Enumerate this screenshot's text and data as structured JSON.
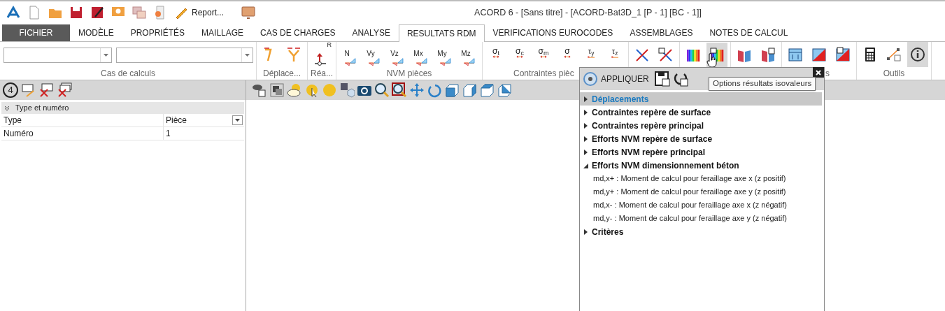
{
  "quick_access": {
    "report_label": "Report..."
  },
  "window_title": "ACORD 6 - [Sans titre] - [ACORD-Bat3D_1 [P - 1] [BC - 1]]",
  "tabs": [
    {
      "label": "FICHIER",
      "selected": false,
      "kind": "file"
    },
    {
      "label": "MODÈLE",
      "selected": false,
      "kind": "tab"
    },
    {
      "label": "PROPRIÉTÉS",
      "selected": false,
      "kind": "tab"
    },
    {
      "label": "MAILLAGE",
      "selected": false,
      "kind": "tab"
    },
    {
      "label": "CAS DE CHARGES",
      "selected": false,
      "kind": "tab"
    },
    {
      "label": "ANALYSE",
      "selected": false,
      "kind": "tab"
    },
    {
      "label": "RESULTATS RDM",
      "selected": true,
      "kind": "tab"
    },
    {
      "label": "VERIFICATIONS EUROCODES",
      "selected": false,
      "kind": "tab"
    },
    {
      "label": "ASSEMBLAGES",
      "selected": false,
      "kind": "tab"
    },
    {
      "label": "NOTES DE CALCUL",
      "selected": false,
      "kind": "tab"
    }
  ],
  "ribbon_groups": [
    {
      "label": "Cas de calculs",
      "kind": "combos"
    },
    {
      "label": "Déplace...",
      "kind": "buttons",
      "buttons": [
        {
          "kind": "deform",
          "highlighted": false
        },
        {
          "kind": "deform2",
          "highlighted": false
        }
      ]
    },
    {
      "label": "Réa...",
      "kind": "buttons",
      "buttons": [
        {
          "kind": "reaction",
          "text": "R",
          "highlighted": false
        }
      ]
    },
    {
      "label": "NVM pièces",
      "kind": "buttons",
      "buttons": [
        {
          "kind": "nvm",
          "text": "N",
          "highlighted": false
        },
        {
          "kind": "nvm",
          "text": "Vy",
          "highlighted": false
        },
        {
          "kind": "nvm",
          "text": "Vz",
          "highlighted": false
        },
        {
          "kind": "nvm",
          "text": "Mx",
          "highlighted": false
        },
        {
          "kind": "nvm",
          "text": "My",
          "highlighted": false
        },
        {
          "kind": "nvm",
          "text": "Mz",
          "highlighted": false
        }
      ]
    },
    {
      "label": "Contraintes pièc",
      "kind": "buttons",
      "buttons": [
        {
          "kind": "stress",
          "text": "σ$_{t}$",
          "highlighted": false
        },
        {
          "kind": "stress",
          "text": "σ$_{c}$",
          "highlighted": false
        },
        {
          "kind": "stress",
          "text": "σ$_{m}$",
          "highlighted": false
        },
        {
          "kind": "stress",
          "text": "σ",
          "highlighted": false
        },
        {
          "kind": "shear",
          "text": "τ$_{y}$",
          "highlighted": false
        },
        {
          "kind": "shear",
          "text": "τ$_{z}$",
          "highlighted": false
        }
      ]
    },
    {
      "kind": "buttons",
      "buttons": [
        {
          "kind": "cross",
          "highlighted": false
        },
        {
          "kind": "cross-check",
          "highlighted": false
        }
      ]
    },
    {
      "kind": "buttons",
      "buttons": [
        {
          "kind": "spectrum",
          "highlighted": false
        },
        {
          "kind": "spectrum-check",
          "highlighted": true
        }
      ]
    },
    {
      "kind": "buttons",
      "buttons": [
        {
          "kind": "book",
          "highlighted": false
        },
        {
          "kind": "book-check",
          "highlighted": false
        }
      ]
    },
    {
      "label": "s",
      "kind": "buttons",
      "buttons": [
        {
          "kind": "panel",
          "highlighted": false
        },
        {
          "kind": "panel-diag",
          "highlighted": false
        },
        {
          "kind": "panel-check",
          "highlighted": false
        }
      ]
    },
    {
      "label": "Outils",
      "kind": "buttons",
      "buttons": [
        {
          "kind": "calculator",
          "highlighted": false
        },
        {
          "kind": "measure",
          "highlighted": false
        },
        {
          "kind": "info",
          "highlighted": true
        }
      ]
    }
  ],
  "left_panel": {
    "badge": "4",
    "section": {
      "label": "Type et numéro",
      "expanded": true
    },
    "rows": [
      {
        "name": "Type",
        "value": "Pièce",
        "kind": "dropdown"
      },
      {
        "name": "Numéro",
        "value": "1",
        "kind": "text"
      }
    ]
  },
  "popup": {
    "apply_label": "APPLIQUER",
    "items": [
      {
        "label": "Déplacements",
        "expanded": false,
        "selected": true
      },
      {
        "label": "Contraintes repère de surface",
        "expanded": false,
        "selected": false
      },
      {
        "label": "Contraintes repère principal",
        "expanded": false,
        "selected": false
      },
      {
        "label": "Efforts NVM repère de surface",
        "expanded": false,
        "selected": false
      },
      {
        "label": "Efforts NVM repère principal",
        "expanded": false,
        "selected": false
      },
      {
        "label": "Efforts NVM dimensionnement béton",
        "expanded": true,
        "selected": false,
        "children": [
          {
            "label": "md,x+ : Moment de calcul pour feraillage axe x (z positif)",
            "selected": false
          },
          {
            "label": "md,y+ : Moment de calcul pour feraillage axe y (z positif)",
            "selected": false
          },
          {
            "label": "md,x- : Moment de calcul pour feraillage axe x (z négatif)",
            "selected": false
          },
          {
            "label": "md,y- : Moment de calcul pour feraillage axe y (z négatif)",
            "selected": false
          }
        ]
      },
      {
        "label": "Critères",
        "expanded": false,
        "selected": false
      }
    ]
  },
  "tooltip": "Options résultats isovaleurs"
}
